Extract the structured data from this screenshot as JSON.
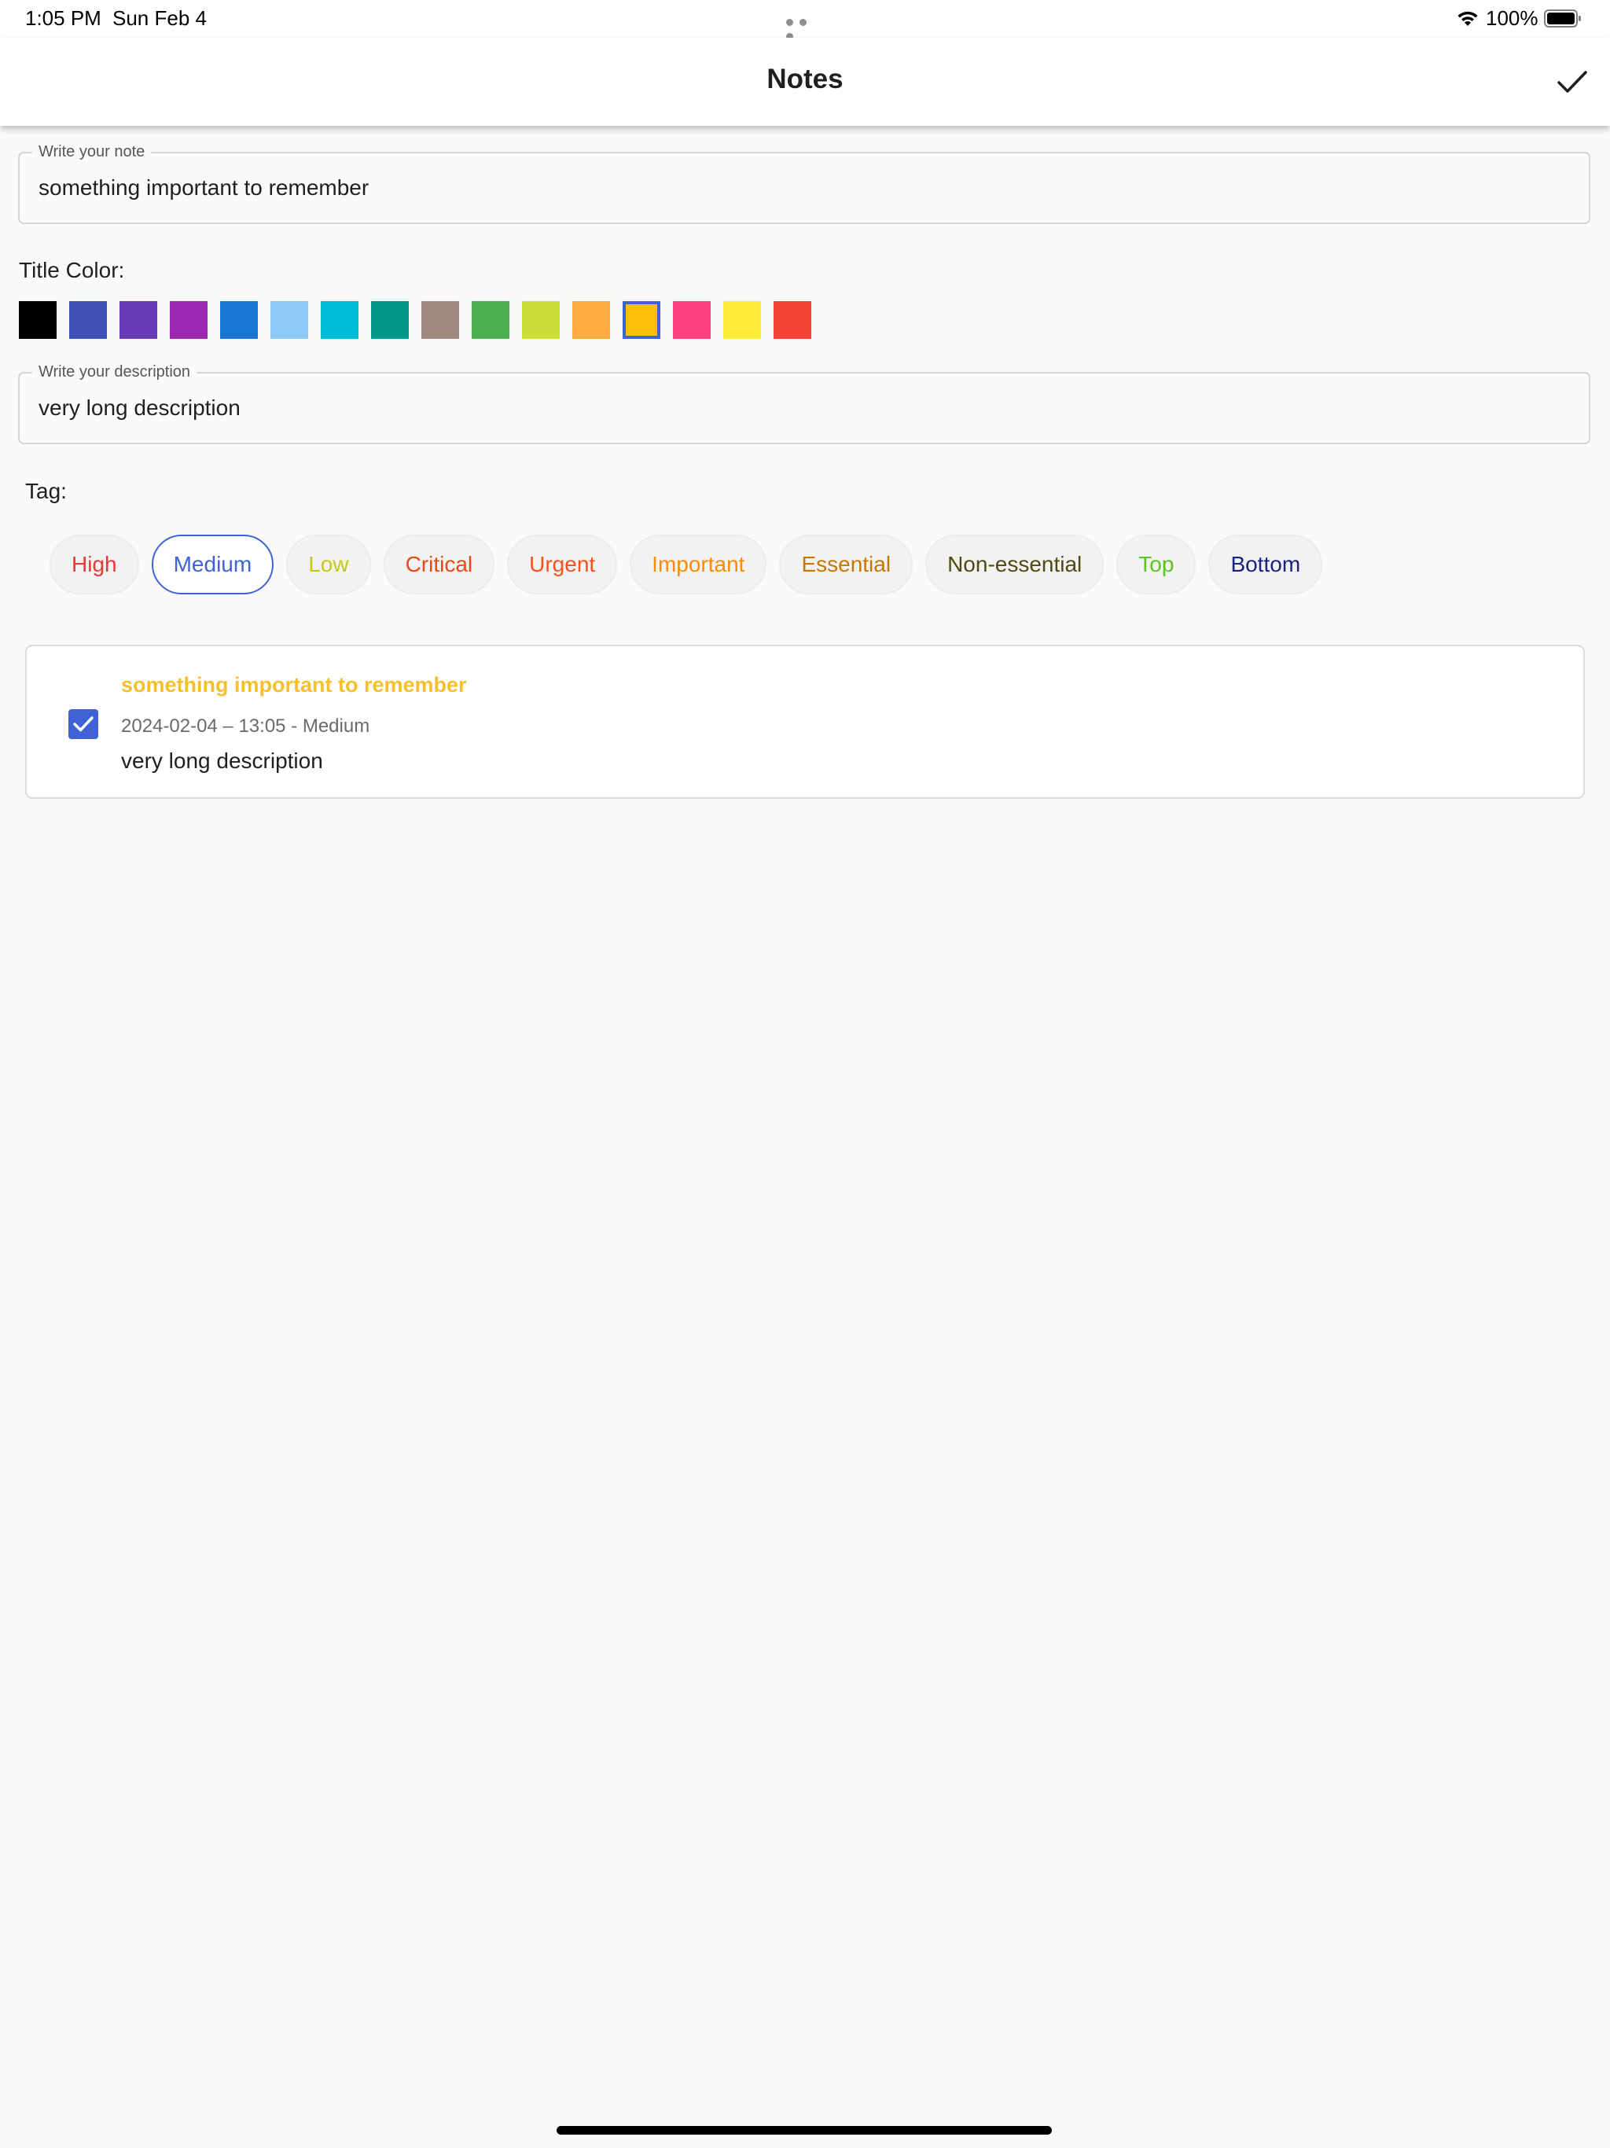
{
  "status_bar": {
    "time": "1:05 PM",
    "date": "Sun Feb 4",
    "battery": "100%"
  },
  "app_bar": {
    "title": "Notes",
    "save_icon": "check-icon"
  },
  "note_field": {
    "label": "Write your note",
    "value": "something important to remember"
  },
  "title_color": {
    "label": "Title Color:",
    "colors": [
      "#000000",
      "#3f51b5",
      "#673ab7",
      "#9c27b0",
      "#1976d2",
      "#90caf9",
      "#00bcd4",
      "#009688",
      "#a1887f",
      "#4caf50",
      "#cddc39",
      "#ffab40",
      "#ffc107",
      "#ff4081",
      "#ffeb3b",
      "#f44336"
    ],
    "selected_index": 12,
    "selected_border": "#3f63d7"
  },
  "description_field": {
    "label": "Write your description",
    "value": "very long description"
  },
  "tags": {
    "label": "Tag:",
    "items": [
      {
        "label": "High",
        "color": "#e53935"
      },
      {
        "label": "Medium",
        "color": "#3f63d7"
      },
      {
        "label": "Low",
        "color": "#c8c81a"
      },
      {
        "label": "Critical",
        "color": "#e64a19"
      },
      {
        "label": "Urgent",
        "color": "#f4511e"
      },
      {
        "label": "Important",
        "color": "#fb8c00"
      },
      {
        "label": "Essential",
        "color": "#c77700"
      },
      {
        "label": "Non-essential",
        "color": "#4e4a12"
      },
      {
        "label": "Top",
        "color": "#5cc41a"
      },
      {
        "label": "Bottom",
        "color": "#1a237e"
      }
    ],
    "selected": "Medium"
  },
  "note": {
    "title": "something important to remember",
    "meta": "2024-02-04 – 13:05 - Medium",
    "description": "very long description",
    "checked": true,
    "title_color": "#f6c02d",
    "checkbox_color": "#3f63d7"
  }
}
